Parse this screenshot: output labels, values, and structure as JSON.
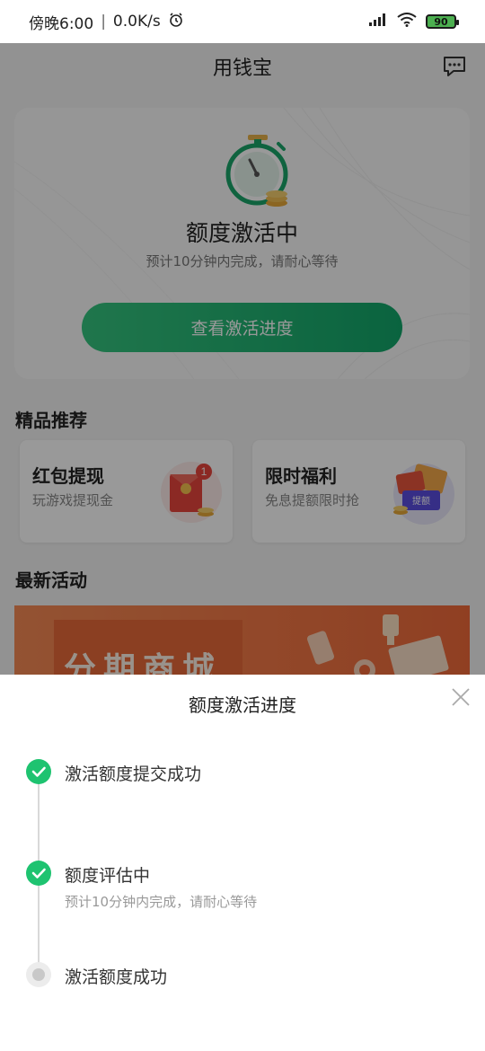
{
  "statusbar": {
    "time": "傍晚6:00",
    "separator": "|",
    "speed": "0.0K/s",
    "battery": "90"
  },
  "header": {
    "title": "用钱宝"
  },
  "activation_card": {
    "status": "额度激活中",
    "subtitle": "预计10分钟内完成，请耐心等待",
    "button": "查看激活进度"
  },
  "featured": {
    "title": "精品推荐",
    "items": [
      {
        "name": "红包提现",
        "desc": "玩游戏提现金",
        "badge": "1"
      },
      {
        "name": "限时福利",
        "desc": "免息提额限时抢",
        "tag": "提额"
      }
    ]
  },
  "latest": {
    "title": "最新活动",
    "banner_text": "分期商城"
  },
  "sheet": {
    "title": "额度激活进度",
    "steps": [
      {
        "label": "激活额度提交成功",
        "state": "done"
      },
      {
        "label": "额度评估中",
        "sub": "预计10分钟内完成，请耐心等待",
        "state": "done"
      },
      {
        "label": "激活额度成功",
        "state": "pending"
      }
    ]
  },
  "colors": {
    "accent_green": "#1ec370",
    "button_gradient_start": "#35c57f",
    "button_gradient_end": "#12a66a",
    "banner_orange": "#f06a3a"
  }
}
